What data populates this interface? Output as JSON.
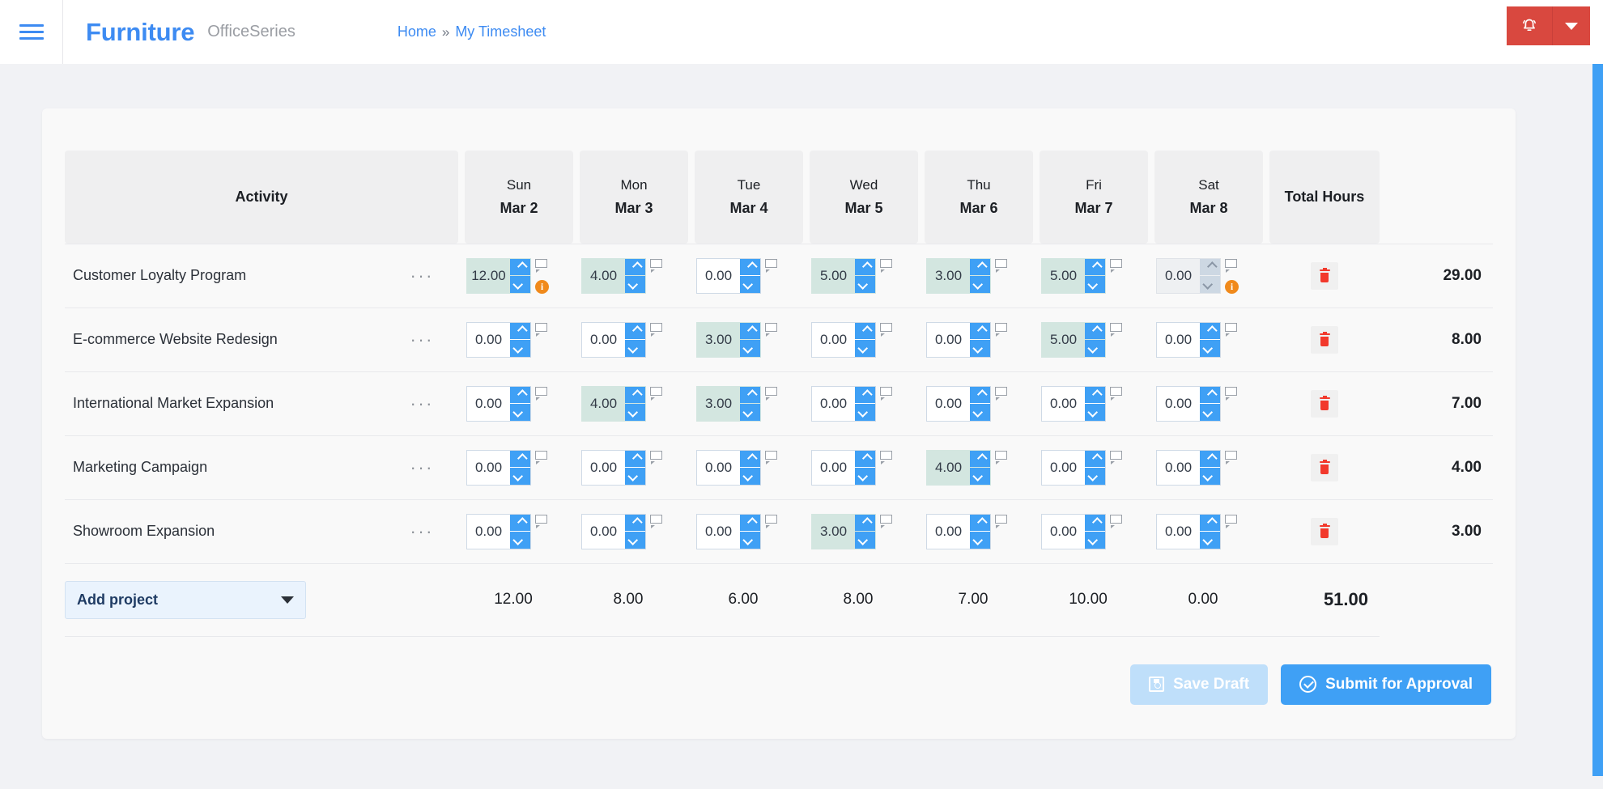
{
  "header": {
    "menu_icon": "hamburger-icon",
    "brand": "Furniture",
    "brand_sub": "OfficeSeries",
    "breadcrumb": {
      "home": "Home",
      "separator": "»",
      "current": "My Timesheet"
    },
    "notification_icon": "bell-icon",
    "dropdown_icon": "chevron-down-icon",
    "accent_red": "#d9483f",
    "accent_blue": "#3d8bf2"
  },
  "table": {
    "activity_header": "Activity",
    "total_header": "Total Hours",
    "days": [
      {
        "dow": "Sun",
        "dom": "Mar 2"
      },
      {
        "dow": "Mon",
        "dom": "Mar 3"
      },
      {
        "dow": "Tue",
        "dom": "Mar 4"
      },
      {
        "dow": "Wed",
        "dom": "Mar 5"
      },
      {
        "dow": "Thu",
        "dom": "Mar 6"
      },
      {
        "dow": "Fri",
        "dom": "Mar 7"
      },
      {
        "dow": "Sat",
        "dom": "Mar 8"
      }
    ],
    "row_menu_label": "···",
    "rows": [
      {
        "activity": "Customer Loyalty Program",
        "hours": [
          "12.00",
          "4.00",
          "0.00",
          "5.00",
          "3.00",
          "5.00",
          "0.00"
        ],
        "filled": [
          true,
          true,
          false,
          true,
          true,
          true,
          false
        ],
        "disabled": [
          false,
          false,
          false,
          false,
          false,
          false,
          true
        ],
        "info": [
          true,
          false,
          false,
          false,
          false,
          false,
          true
        ],
        "total": "29.00"
      },
      {
        "activity": "E-commerce Website Redesign",
        "hours": [
          "0.00",
          "0.00",
          "3.00",
          "0.00",
          "0.00",
          "5.00",
          "0.00"
        ],
        "filled": [
          false,
          false,
          true,
          false,
          false,
          true,
          false
        ],
        "disabled": [
          false,
          false,
          false,
          false,
          false,
          false,
          false
        ],
        "info": [
          false,
          false,
          false,
          false,
          false,
          false,
          false
        ],
        "total": "8.00"
      },
      {
        "activity": "International Market Expansion",
        "hours": [
          "0.00",
          "4.00",
          "3.00",
          "0.00",
          "0.00",
          "0.00",
          "0.00"
        ],
        "filled": [
          false,
          true,
          true,
          false,
          false,
          false,
          false
        ],
        "disabled": [
          false,
          false,
          false,
          false,
          false,
          false,
          false
        ],
        "info": [
          false,
          false,
          false,
          false,
          false,
          false,
          false
        ],
        "total": "7.00"
      },
      {
        "activity": "Marketing Campaign",
        "hours": [
          "0.00",
          "0.00",
          "0.00",
          "0.00",
          "4.00",
          "0.00",
          "0.00"
        ],
        "filled": [
          false,
          false,
          false,
          false,
          true,
          false,
          false
        ],
        "disabled": [
          false,
          false,
          false,
          false,
          false,
          false,
          false
        ],
        "info": [
          false,
          false,
          false,
          false,
          false,
          false,
          false
        ],
        "total": "4.00"
      },
      {
        "activity": "Showroom Expansion",
        "hours": [
          "0.00",
          "0.00",
          "0.00",
          "3.00",
          "0.00",
          "0.00",
          "0.00"
        ],
        "filled": [
          false,
          false,
          false,
          true,
          false,
          false,
          false
        ],
        "disabled": [
          false,
          false,
          false,
          false,
          false,
          false,
          false
        ],
        "info": [
          false,
          false,
          false,
          false,
          false,
          false,
          false
        ],
        "total": "3.00"
      }
    ],
    "footer": {
      "add_project_label": "Add project",
      "day_totals": [
        "12.00",
        "8.00",
        "6.00",
        "8.00",
        "7.00",
        "10.00",
        "0.00"
      ],
      "grand_total": "51.00"
    },
    "icons": {
      "comment": "comment-icon",
      "info": "info-icon",
      "delete": "trash-icon",
      "spin_up": "chevron-up-icon",
      "spin_down": "chevron-down-icon"
    },
    "colors": {
      "filled_cell": "#d3e6e0",
      "spinner_blue": "#3fa0f5",
      "info_orange": "#f08a1c",
      "trash_red": "#f2392c"
    }
  },
  "actions": {
    "save_draft": "Save Draft",
    "save_draft_icon": "floppy-disk-icon",
    "save_draft_disabled": true,
    "submit": "Submit for Approval",
    "submit_icon": "check-circle-icon"
  }
}
